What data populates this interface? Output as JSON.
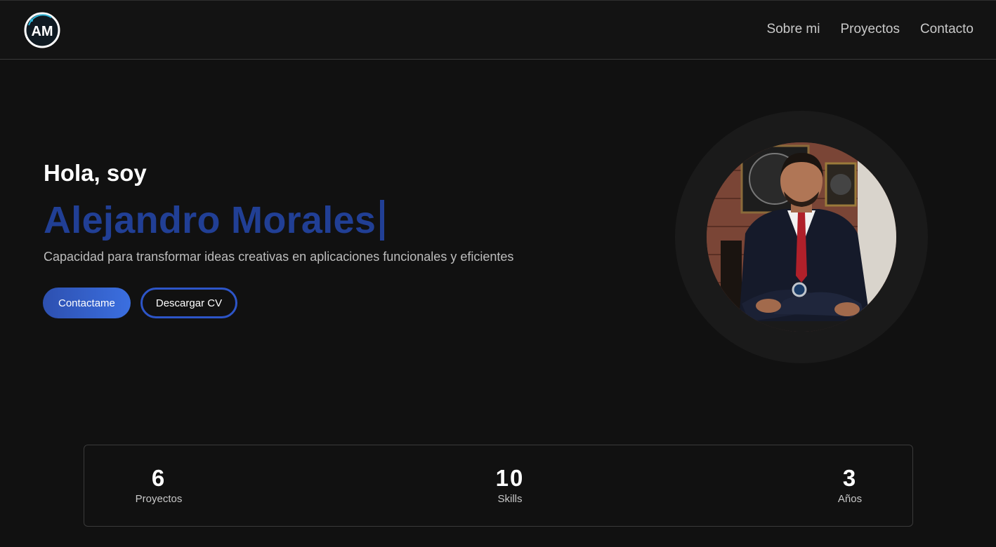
{
  "nav": {
    "logo_text": "AM",
    "links": [
      {
        "label": "Sobre mi"
      },
      {
        "label": "Proyectos"
      },
      {
        "label": "Contacto"
      }
    ]
  },
  "hero": {
    "greeting": "Hola, soy",
    "name": "Alejandro Morales",
    "tagline": "Capacidad para transformar ideas creativas en aplicaciones funcionales y eficientes",
    "primary_button": "Contactame",
    "secondary_button": "Descargar CV",
    "name_color": "#213f95",
    "accent_color": "#3b6fe0"
  },
  "stats": [
    {
      "value": "6",
      "label": "Proyectos"
    },
    {
      "value": "10",
      "label": "Skills"
    },
    {
      "value": "3",
      "label": "Años"
    }
  ]
}
